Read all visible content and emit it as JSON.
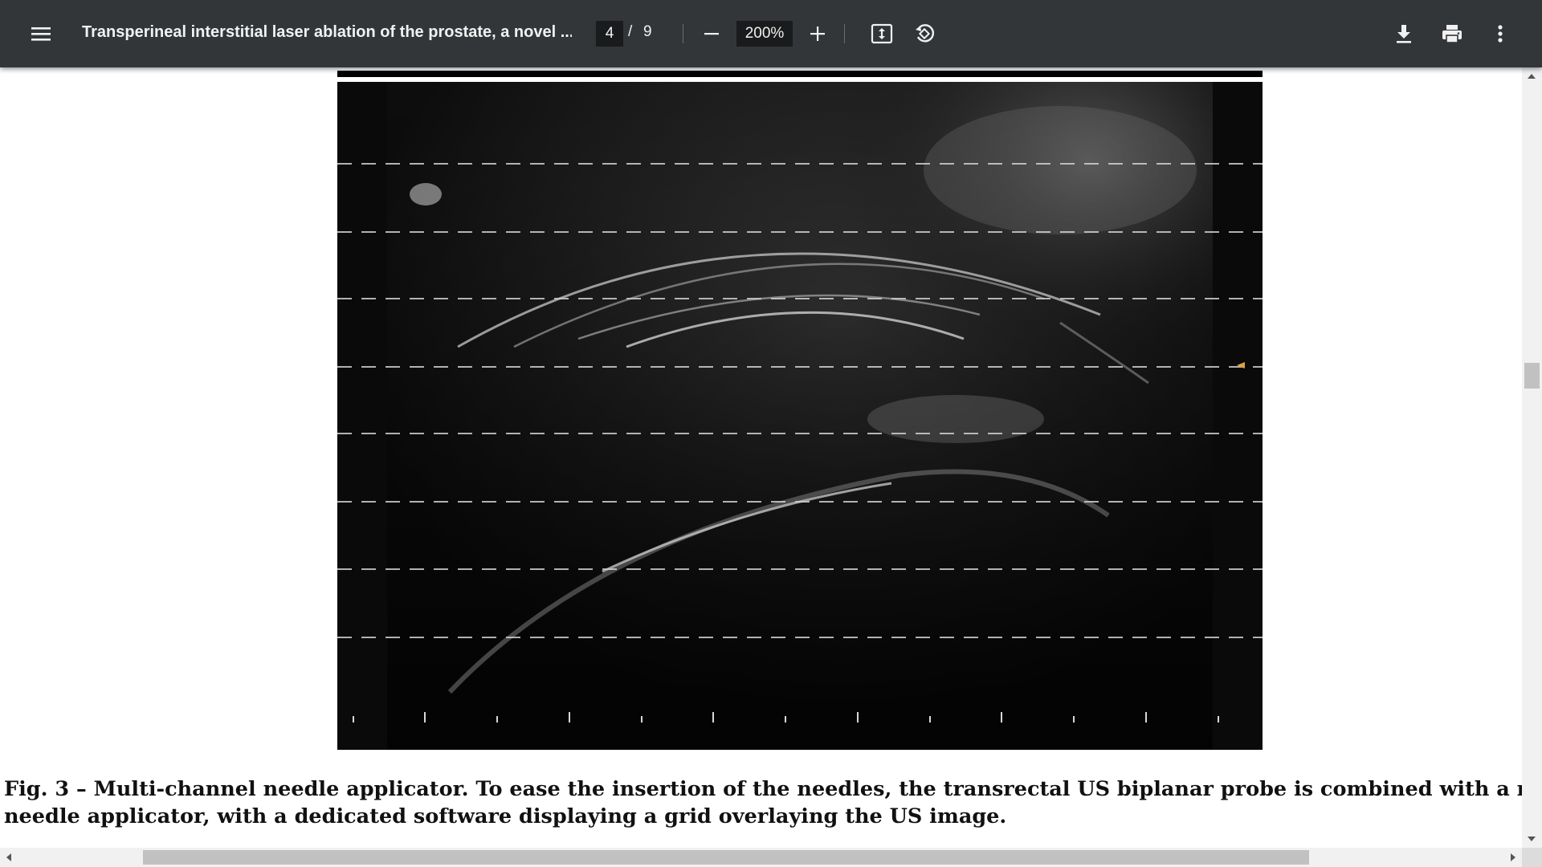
{
  "toolbar": {
    "menu_icon": "hamburger-menu-icon",
    "title": "Transperineal interstitial laser ablation of the prostate, a novel ...",
    "current_page": "4",
    "page_separator": "/",
    "total_pages": "9",
    "zoom_level": "200%",
    "zoom_out_icon": "minus-icon",
    "zoom_in_icon": "plus-icon",
    "fit_icon": "fit-to-page-icon",
    "rotate_icon": "rotate-counterclockwise-icon",
    "download_icon": "download-icon",
    "print_icon": "print-icon",
    "more_icon": "more-vertical-icon",
    "background_color": "#323639"
  },
  "document": {
    "figure": {
      "image_description_icon": "ultrasound-image",
      "grid_overlay": true,
      "marker_color": "#e0a040"
    },
    "caption": {
      "line1": "Fig. 3 – Multi-channel needle applicator. To ease the insertion of the needles, the transrectal US biplanar probe is combined with a multi-channel",
      "line2": "needle applicator, with a dedicated software displaying a grid overlaying the US image."
    }
  },
  "scrollbars": {
    "vertical_position": 0.38,
    "horizontal_position": 0.12
  }
}
